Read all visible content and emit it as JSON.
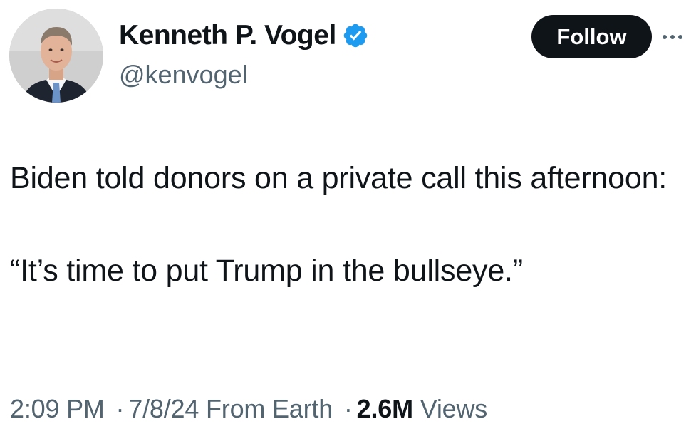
{
  "author": {
    "display_name": "Kenneth P. Vogel",
    "handle": "@kenvogel",
    "verified": true,
    "avatar_icon": "profile-photo",
    "badge_color": "#1d9bf0"
  },
  "actions": {
    "follow_label": "Follow",
    "more_icon": "ellipsis-icon"
  },
  "tweet": {
    "line1": "Biden told donors on a private call this afternoon:",
    "line2": "“It’s time to put Trump in the bullseye.”"
  },
  "meta": {
    "time": "2:09 PM",
    "separator": "·",
    "date": "7/8/24",
    "source": "From Earth",
    "views_count": "2.6M",
    "views_label": "Views"
  },
  "colors": {
    "text": "#0f1419",
    "secondary": "#536471",
    "follow_bg": "#0f1419",
    "verified": "#1d9bf0"
  }
}
